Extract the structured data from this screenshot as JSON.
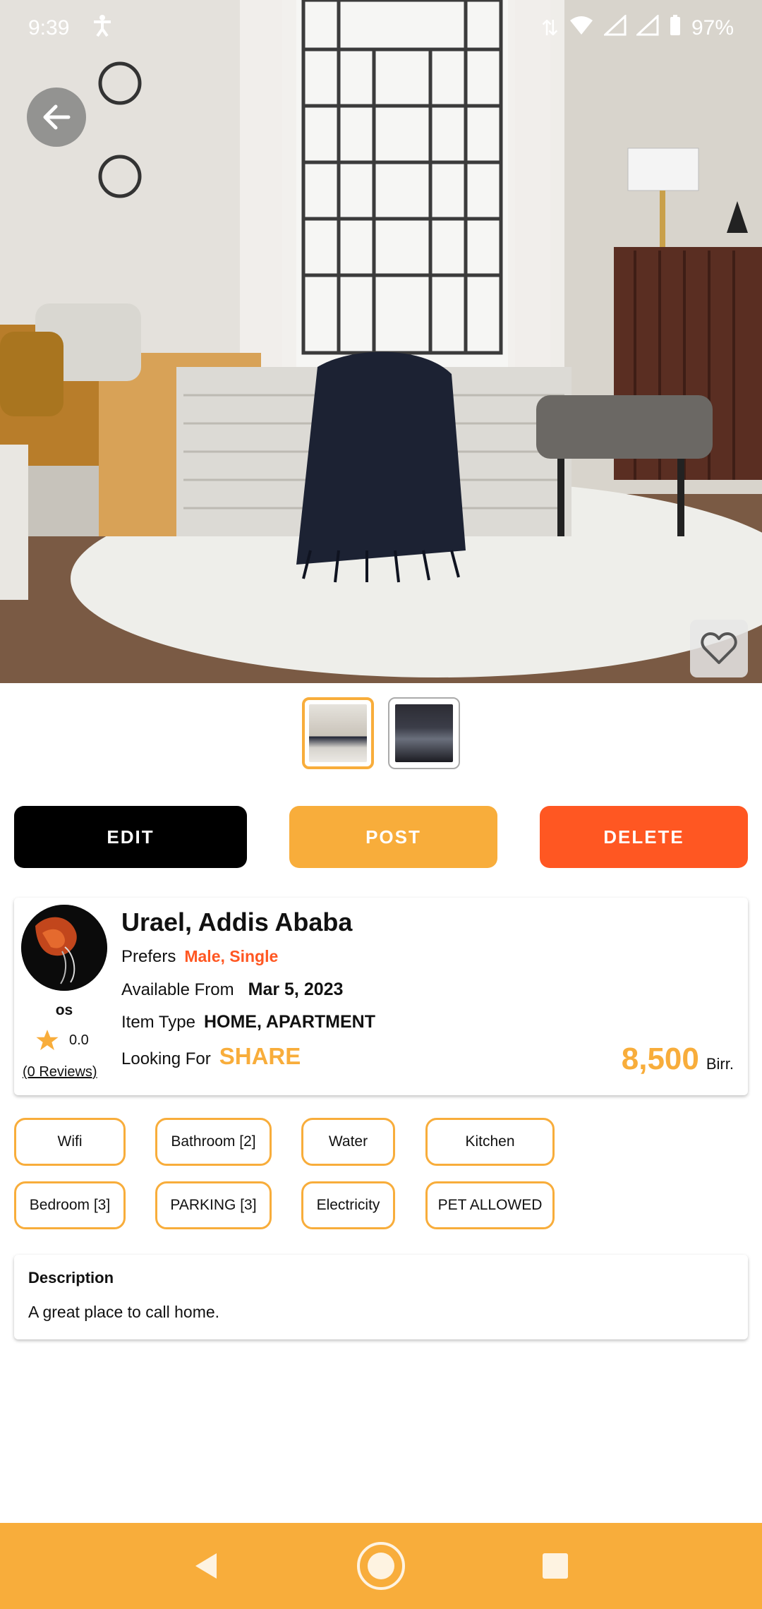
{
  "status_bar": {
    "time": "9:39",
    "battery": "97%"
  },
  "listing": {
    "title": "Urael, Addis Ababa",
    "prefers_label": "Prefers",
    "prefers_value": "Male, Single",
    "available_label": "Available From",
    "available_value": "Mar 5, 2023",
    "item_type_label": "Item Type",
    "item_type_value": "HOME, APARTMENT",
    "looking_for_label": "Looking For",
    "looking_for_value": "SHARE",
    "price": "8,500",
    "currency": "Birr."
  },
  "owner": {
    "name": "os",
    "rating": "0.0",
    "reviews": "(0 Reviews)"
  },
  "actions": {
    "edit": "EDIT",
    "post": "POST",
    "delete": "DELETE"
  },
  "amenities": [
    "Wifi",
    "Bathroom [2]",
    "Water",
    "Kitchen",
    "Bedroom [3]",
    "PARKING [3]",
    "Electricity",
    "PET ALLOWED"
  ],
  "description": {
    "heading": "Description",
    "text": "A great place to call home."
  },
  "thumbnails": {
    "selected_index": 0,
    "count": 2
  },
  "colors": {
    "accent": "#f8ad3b",
    "danger": "#ff5722",
    "dark": "#000000"
  },
  "icons": [
    "back-arrow-icon",
    "heart-icon",
    "star-icon",
    "nav-back-icon",
    "nav-home-icon",
    "nav-recents-icon"
  ]
}
